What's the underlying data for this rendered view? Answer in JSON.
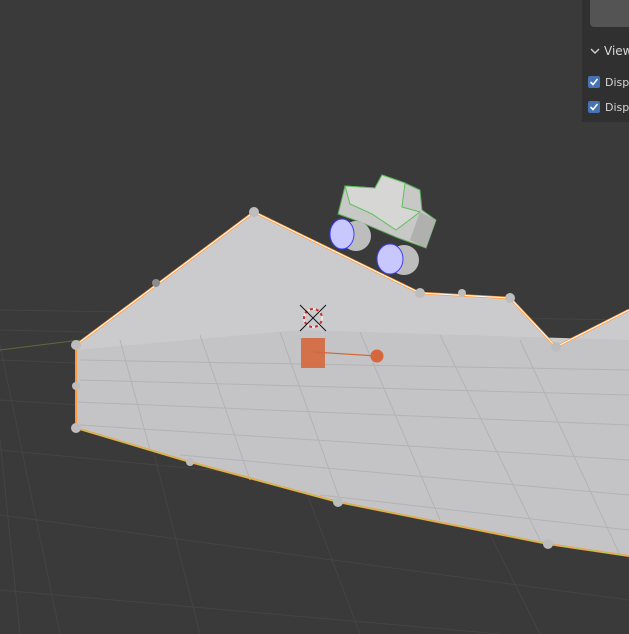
{
  "app": "3D Viewport",
  "colors": {
    "background": "#3a3a3a",
    "grid": "#444444",
    "plane": "#c4c4c6",
    "outline": "#ff9a3c",
    "edge_highlight": "#ffffff",
    "vertex": "#bdbdbd",
    "wheel": "#c8c8ff",
    "wheel_outline": "#3d3dff",
    "car_body": "#c8c8c6",
    "empty_object": "#d4683c",
    "checkbox_accent": "#4772b3"
  },
  "sidebar": {
    "section_title": "View",
    "options": [
      {
        "label": "Displ",
        "checked": true
      },
      {
        "label": "Displ",
        "checked": true
      }
    ]
  },
  "icons": [
    "chevron-down-icon",
    "3d-cursor-icon",
    "checkmark-icon"
  ]
}
